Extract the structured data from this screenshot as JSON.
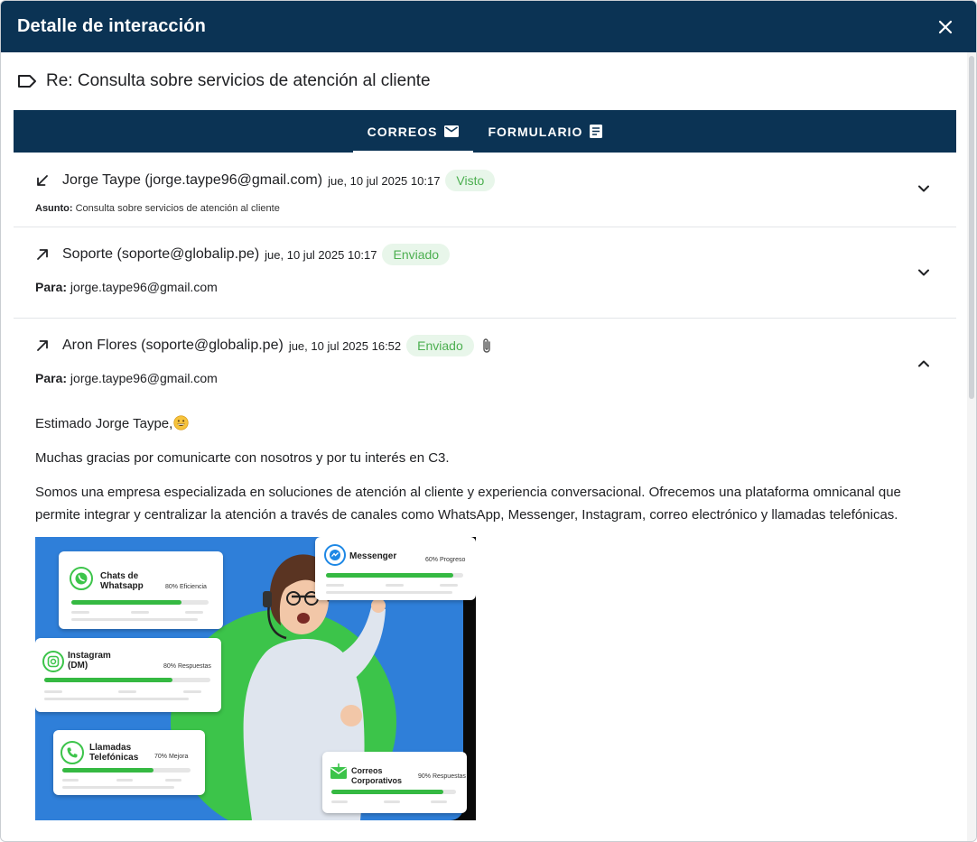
{
  "modal": {
    "title": "Detalle de interacción"
  },
  "subject": "Re: Consulta sobre servicios de atención al cliente",
  "tabs": [
    {
      "label": "CORREOS",
      "icon": "email-icon",
      "active": true
    },
    {
      "label": "FORMULARIO",
      "icon": "form-icon",
      "active": false
    }
  ],
  "emails": [
    {
      "direction": "incoming",
      "sender": "Jorge Taype (jorge.taype96@gmail.com)",
      "date": "jue, 10 jul 2025 10:17",
      "status": "Visto",
      "meta_label": "Asunto:",
      "meta_value": "Consulta sobre servicios de atención al cliente"
    },
    {
      "direction": "outgoing",
      "sender": "Soporte (soporte@globalip.pe)",
      "date": "jue, 10 jul 2025 10:17",
      "status": "Enviado",
      "meta_label": "Para:",
      "meta_value": "jorge.taype96@gmail.com"
    },
    {
      "direction": "outgoing",
      "sender": "Aron Flores (soporte@globalip.pe)",
      "date": "jue, 10 jul 2025 16:52",
      "status": "Enviado",
      "has_attachment": true,
      "meta_label": "Para:",
      "meta_value": "jorge.taype96@gmail.com",
      "body": {
        "greeting": "Estimado Jorge Taype,",
        "p1": "Muchas gracias por comunicarte con nosotros y por tu interés en C3.",
        "p2": "Somos una empresa especializada en soluciones de atención al cliente y experiencia conversacional. Ofrecemos una plataforma omnicanal que permite integrar y centralizar la atención a través de canales como WhatsApp, Messenger, Instagram, correo electrónico y llamadas telefónicas."
      }
    }
  ],
  "promo": {
    "cards": {
      "whatsapp": {
        "title1": "Chats de",
        "title2": "Whatsapp",
        "stat": "80% Eficiencia",
        "progress": 0.8
      },
      "messenger": {
        "title": "Messenger",
        "stat": "60% Progreso",
        "progress": 0.93
      },
      "instagram": {
        "title1": "Instagram",
        "title2": "(DM)",
        "stat": "80% Respuestas",
        "progress": 0.77
      },
      "calls": {
        "title1": "Llamadas",
        "title2": "Telefónicas",
        "stat": "70% Mejora",
        "progress": 0.71
      },
      "mail": {
        "title1": "Correos",
        "title2": "Corporativos",
        "stat": "90% Respuestas",
        "progress": 0.9
      }
    }
  },
  "colors": {
    "header_bg": "#0b3354",
    "badge_bg": "#e8f6ea",
    "badge_text": "#4caf50",
    "promo_blue": "#2f7fd9",
    "promo_green": "#3cc44a"
  }
}
